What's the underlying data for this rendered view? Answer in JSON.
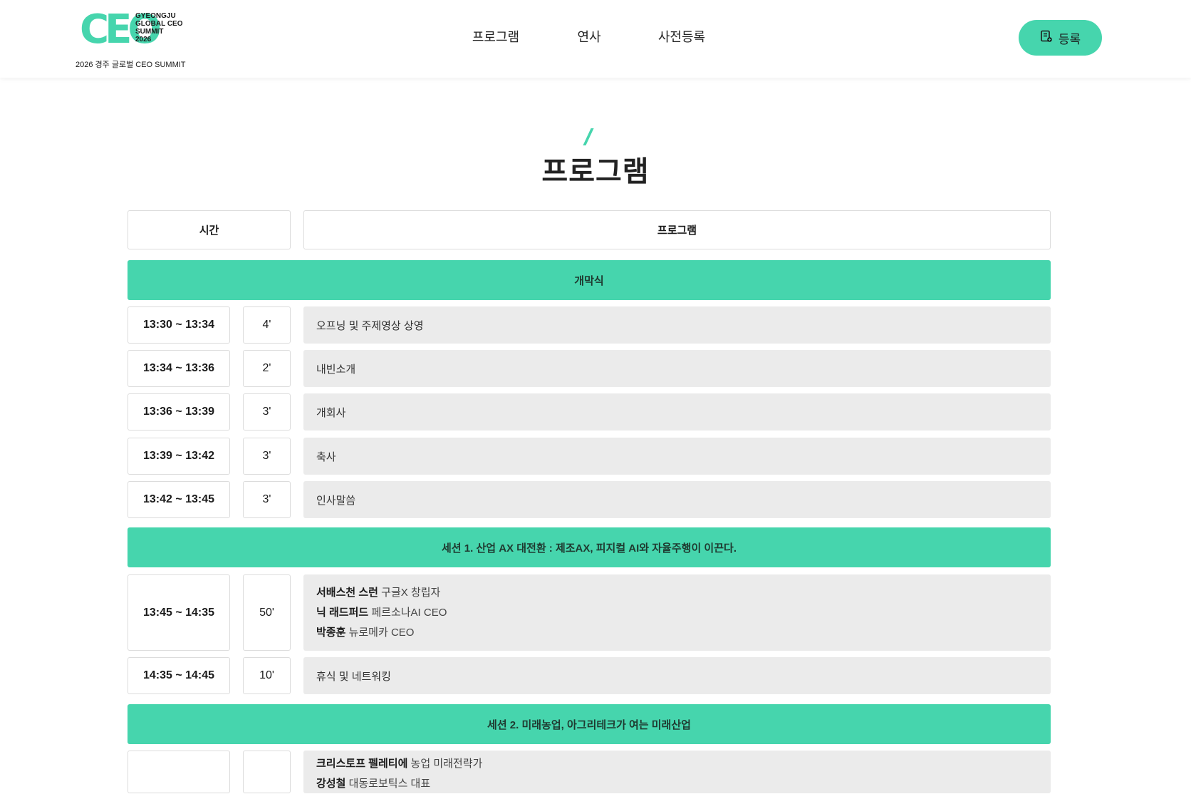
{
  "header": {
    "logo_mark": "CEO",
    "logo_text": "GYEONGJU\nGLOBAL CEO\nSUMMIT\n2026",
    "logo_sub": "2026 경주 글로벌 CEO SUMMIT",
    "nav": [
      "프로그램",
      "연사",
      "사전등록"
    ],
    "register_label": "등록",
    "accent_color": "#46d5ad"
  },
  "page_title": "프로그램",
  "table": {
    "head_time": "시간",
    "head_program": "프로그램"
  },
  "sections": [
    {
      "title": "개막식",
      "rows": [
        {
          "time": "13:30 ~ 13:34",
          "duration": "4'",
          "program": "오프닝 및 주제영상 상영"
        },
        {
          "time": "13:34 ~ 13:36",
          "duration": "2'",
          "program": "내빈소개"
        },
        {
          "time": "13:36 ~ 13:39",
          "duration": "3'",
          "program": "개회사"
        },
        {
          "time": "13:39 ~ 13:42",
          "duration": "3'",
          "program": "축사"
        },
        {
          "time": "13:42 ~ 13:45",
          "duration": "3'",
          "program": "인사말씀"
        }
      ]
    },
    {
      "title": "세션 1. 산업 AX 대전환 : 제조AX, 피지컬 AI와 자율주행이 이끈다.",
      "rows": [
        {
          "time": "13:45 ~ 14:35",
          "duration": "50'",
          "speakers": [
            {
              "name": "서배스천 스런",
              "role": "구글X 창립자"
            },
            {
              "name": "닉 래드퍼드",
              "role": "페르소나AI CEO"
            },
            {
              "name": "박종훈",
              "role": "뉴로메카 CEO"
            }
          ]
        },
        {
          "time": "14:35 ~ 14:45",
          "duration": "10'",
          "program": "휴식 및 네트워킹"
        }
      ]
    },
    {
      "title": "세션 2. 미래농업, 아그리테크가 여는 미래산업",
      "rows": [
        {
          "time": "",
          "duration": "",
          "speakers": [
            {
              "name": "크리스토프 펠레티에",
              "role": "농업 미래전략가"
            },
            {
              "name": "강성철",
              "role": "대동로보틱스 대표"
            }
          ]
        }
      ]
    }
  ]
}
